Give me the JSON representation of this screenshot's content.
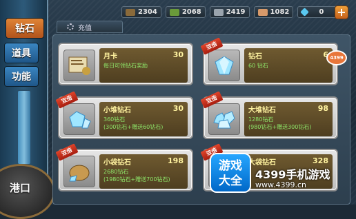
{
  "tabs": [
    {
      "label": "钻石",
      "active": true
    },
    {
      "label": "道具",
      "active": false
    },
    {
      "label": "功能",
      "active": false
    }
  ],
  "harbor_label": "港口",
  "resources": [
    {
      "icon": "wood-icon",
      "value": "2304",
      "color": "#8a6a3a"
    },
    {
      "icon": "oil-icon",
      "value": "2068",
      "color": "#6a9a3a"
    },
    {
      "icon": "steel-icon",
      "value": "2419",
      "color": "#9aa4ad"
    },
    {
      "icon": "food-icon",
      "value": "1082",
      "color": "#d89a6a"
    },
    {
      "icon": "diamond-icon",
      "value": "0",
      "color": "#5ac8f0"
    }
  ],
  "plus_label": "+",
  "section_tab": "充值",
  "badge_label": "双倍",
  "cards": [
    {
      "name": "月卡",
      "price": "30",
      "desc": [
        "每日可领钻石奖励"
      ],
      "icon": "monthly-card-icon",
      "badge": false
    },
    {
      "name": "钻石",
      "price": "6",
      "desc": [
        "60 钻石"
      ],
      "icon": "diamond-icon",
      "badge": true
    },
    {
      "name": "小堆钻石",
      "price": "30",
      "desc": [
        "360钻石",
        "(300钻石+赠送60钻石)"
      ],
      "icon": "diamond-pile-small-icon",
      "badge": true
    },
    {
      "name": "大堆钻石",
      "price": "98",
      "desc": [
        "1280钻石",
        "(980钻石+赠送300钻石)"
      ],
      "icon": "diamond-pile-large-icon",
      "badge": true
    },
    {
      "name": "小袋钻石",
      "price": "198",
      "desc": [
        "2680钻石",
        "(1980钻石+赠送700钻石)"
      ],
      "icon": "diamond-bag-small-icon",
      "badge": true
    },
    {
      "name": "大袋钻石",
      "price": "328",
      "desc": [
        ""
      ],
      "icon": "diamond-bag-large-icon",
      "badge": true
    }
  ],
  "watermark": {
    "logo_line1": "游戏",
    "logo_line2": "大全",
    "site_name": "4399手机游戏",
    "site_url": "www.4399.cn",
    "corner": "4399"
  }
}
